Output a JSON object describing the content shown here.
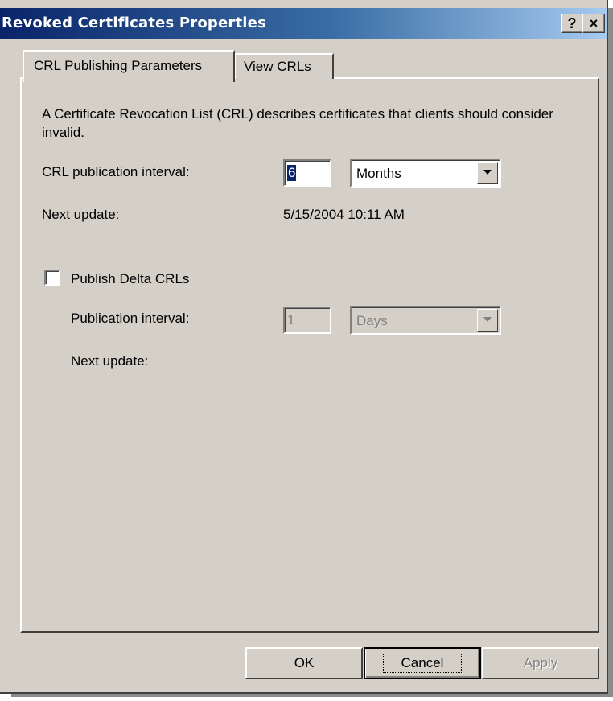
{
  "window": {
    "title": "Revoked Certificates Properties",
    "help_button": "?",
    "close_button": "×"
  },
  "tabs": [
    {
      "label": "CRL Publishing Parameters",
      "active": true
    },
    {
      "label": "View CRLs",
      "active": false
    }
  ],
  "main": {
    "description": "A Certificate Revocation List (CRL) describes certificates that clients should consider invalid.",
    "crl_interval": {
      "label": "CRL publication interval:",
      "value": "6",
      "unit": "Months",
      "next_update_label": "Next update:",
      "next_update_value": "5/15/2004 10:11 AM"
    },
    "delta": {
      "checkbox_label": "Publish Delta CRLs",
      "checked": false,
      "interval_label": "Publication interval:",
      "interval_value": "1",
      "interval_unit": "Days",
      "next_update_label": "Next update:"
    }
  },
  "buttons": {
    "ok": "OK",
    "cancel": "Cancel",
    "apply": "Apply"
  }
}
